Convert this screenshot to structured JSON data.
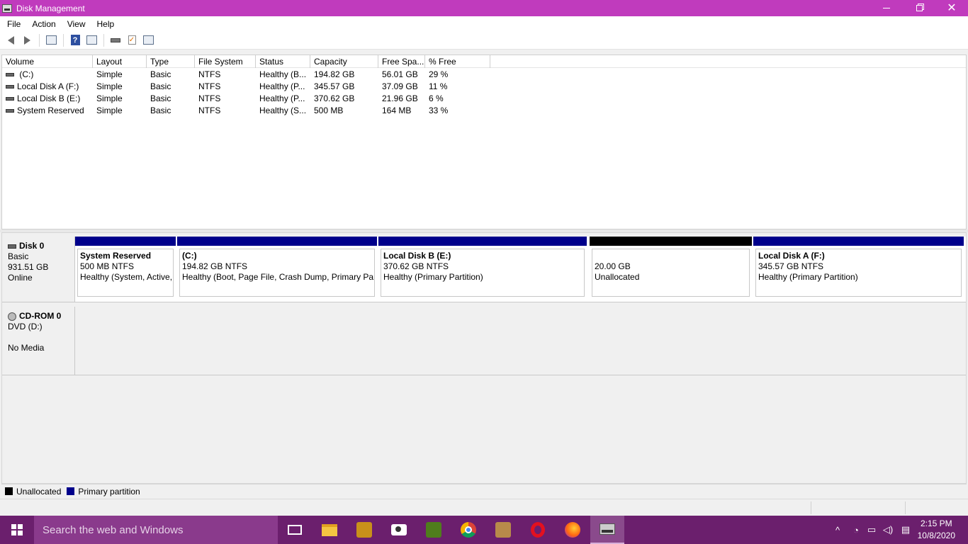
{
  "window": {
    "title": "Disk Management",
    "titlebar_color": "#c03bbd"
  },
  "menu": [
    "File",
    "Action",
    "View",
    "Help"
  ],
  "toolbar": {
    "icons": [
      "back-icon",
      "forward-icon",
      "console-tree-icon",
      "help-icon",
      "show-hide-pane-icon",
      "connect-disk-icon",
      "check-icon",
      "properties-icon"
    ]
  },
  "volume_list": {
    "columns": [
      "Volume",
      "Layout",
      "Type",
      "File System",
      "Status",
      "Capacity",
      "Free Spa...",
      "% Free"
    ],
    "rows": [
      {
        "volume": " (C:)",
        "layout": "Simple",
        "type": "Basic",
        "fs": "NTFS",
        "status": "Healthy (B...",
        "capacity": "194.82 GB",
        "free": "56.01 GB",
        "pct": "29 %"
      },
      {
        "volume": "Local Disk A (F:)",
        "layout": "Simple",
        "type": "Basic",
        "fs": "NTFS",
        "status": "Healthy (P...",
        "capacity": "345.57 GB",
        "free": "37.09 GB",
        "pct": "11 %"
      },
      {
        "volume": "Local Disk B (E:)",
        "layout": "Simple",
        "type": "Basic",
        "fs": "NTFS",
        "status": "Healthy (P...",
        "capacity": "370.62 GB",
        "free": "21.96 GB",
        "pct": "6 %"
      },
      {
        "volume": "System Reserved",
        "layout": "Simple",
        "type": "Basic",
        "fs": "NTFS",
        "status": "Healthy (S...",
        "capacity": "500 MB",
        "free": "164 MB",
        "pct": "33 %"
      }
    ]
  },
  "disks": {
    "disk0": {
      "name": "Disk 0",
      "kind": "Basic",
      "size": "931.51 GB",
      "state": "Online",
      "partitions": [
        {
          "name": "System Reserved",
          "size": "500 MB NTFS",
          "status": "Healthy (System, Active,",
          "kind": "primary"
        },
        {
          "name": " (C:)",
          "size": "194.82 GB NTFS",
          "status": "Healthy (Boot, Page File, Crash Dump, Primary Part",
          "kind": "primary"
        },
        {
          "name": "Local Disk B  (E:)",
          "size": "370.62 GB NTFS",
          "status": "Healthy (Primary Partition)",
          "kind": "primary"
        },
        {
          "name": "",
          "size": "20.00 GB",
          "status": "Unallocated",
          "kind": "unallocated"
        },
        {
          "name": "Local Disk A  (F:)",
          "size": "345.57 GB NTFS",
          "status": "Healthy (Primary Partition)",
          "kind": "primary"
        }
      ]
    },
    "cdrom0": {
      "name": "CD-ROM 0",
      "drive": "DVD (D:)",
      "media": "No Media"
    }
  },
  "legend": {
    "unallocated": "Unallocated",
    "primary": "Primary partition",
    "unallocated_color": "#000000",
    "primary_color": "#00008b"
  },
  "taskbar": {
    "search_placeholder": "Search the web and Windows",
    "apps": [
      "task-view-icon",
      "file-explorer-icon",
      "app-icon",
      "camera-icon",
      "app-icon",
      "chrome-icon",
      "game-icon",
      "opera-icon",
      "firefox-icon",
      "disk-management-icon"
    ],
    "time": "2:15 PM",
    "date": "10/8/2020"
  }
}
